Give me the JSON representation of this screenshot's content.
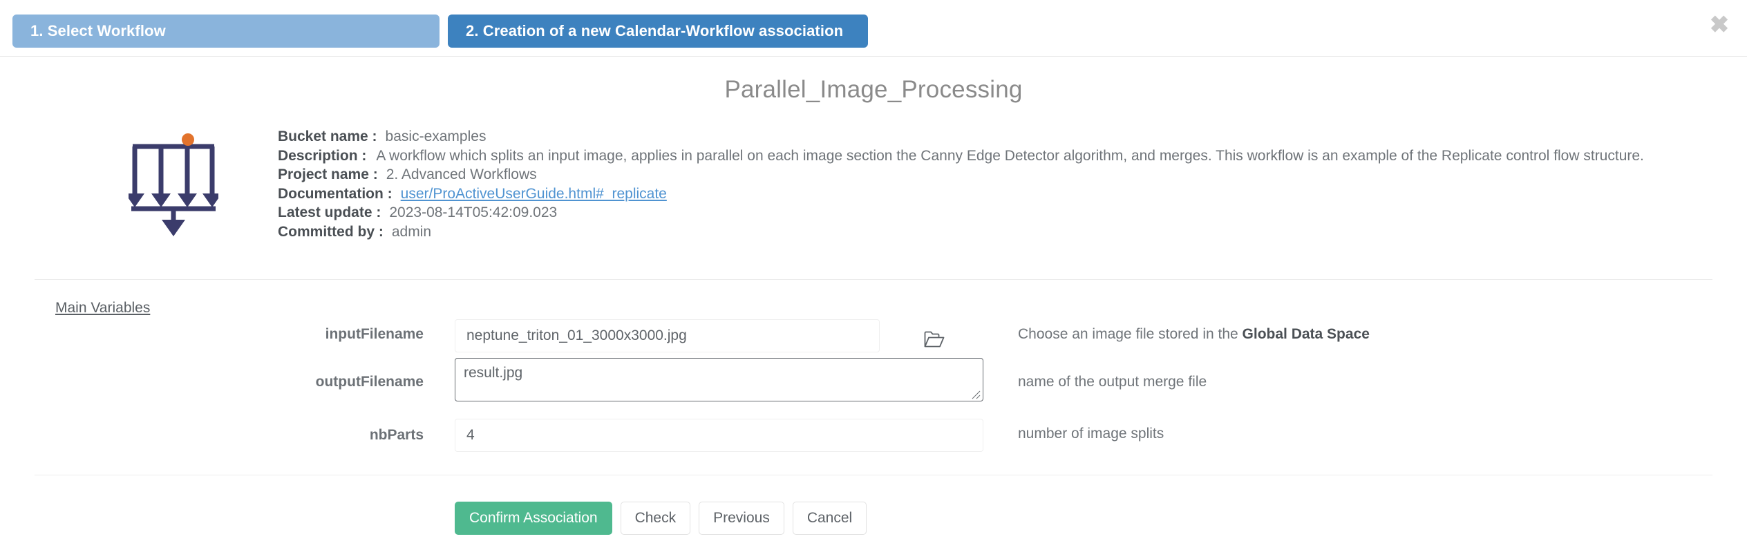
{
  "wizard": {
    "tabs": [
      {
        "label": "1. Select Workflow",
        "color": "#8ab4dc",
        "active": false
      },
      {
        "label": "2. Creation of a new Calendar-Workflow association",
        "color": "#3d82bf",
        "active": true
      }
    ]
  },
  "close_label": "✖",
  "workflow": {
    "title": "Parallel_Image_Processing",
    "icon_name": "replicate-fork-join-icon",
    "icon_colors": {
      "stroke": "#3b3c6b",
      "dot": "#e2732c"
    },
    "info": [
      {
        "key": "Bucket name :",
        "value": "basic-examples",
        "link": false
      },
      {
        "key": "Description :",
        "value": "A workflow which splits an input image, applies in parallel on each image section the Canny Edge Detector algorithm, and merges. This workflow is an example of the Replicate control flow structure.",
        "link": false
      },
      {
        "key": "Project name :",
        "value": "2. Advanced Workflows",
        "link": false
      },
      {
        "key": "Documentation :",
        "value": "user/ProActiveUserGuide.html#_replicate",
        "link": true
      },
      {
        "key": "Latest update :",
        "value": "2023-08-14T05:42:09.023",
        "link": false
      },
      {
        "key": "Committed by :",
        "value": "admin",
        "link": false
      }
    ]
  },
  "variables": {
    "section_label": "Main Variables",
    "rows": [
      {
        "label": "inputFilename",
        "value": "neptune_triton_01_3000x3000.jpg",
        "placeholder": "",
        "help_prefix": "Choose an image file stored in the ",
        "help_bold": "Global Data Space",
        "help_suffix": "",
        "kind": "input",
        "has_browse": true,
        "browse_icon": "open-folder-icon"
      },
      {
        "label": "outputFilename",
        "value": "result.jpg",
        "placeholder": "",
        "help_prefix": "name of the output merge file",
        "help_bold": "",
        "help_suffix": "",
        "kind": "textarea",
        "has_browse": false,
        "browse_icon": ""
      },
      {
        "label": "nbParts",
        "value": "4",
        "placeholder": "",
        "help_prefix": "number of image splits",
        "help_bold": "",
        "help_suffix": "",
        "kind": "input",
        "has_browse": false,
        "browse_icon": ""
      }
    ]
  },
  "footer": {
    "buttons": [
      {
        "label": "Confirm Association",
        "style": "primary"
      },
      {
        "label": "Check",
        "style": "default"
      },
      {
        "label": "Previous",
        "style": "default"
      },
      {
        "label": "Cancel",
        "style": "default"
      }
    ]
  },
  "colors": {
    "primary_green": "#4fb98f",
    "tab_active": "#3d82bf",
    "tab_inactive": "#8ab4dc",
    "link": "#4f93d1"
  }
}
